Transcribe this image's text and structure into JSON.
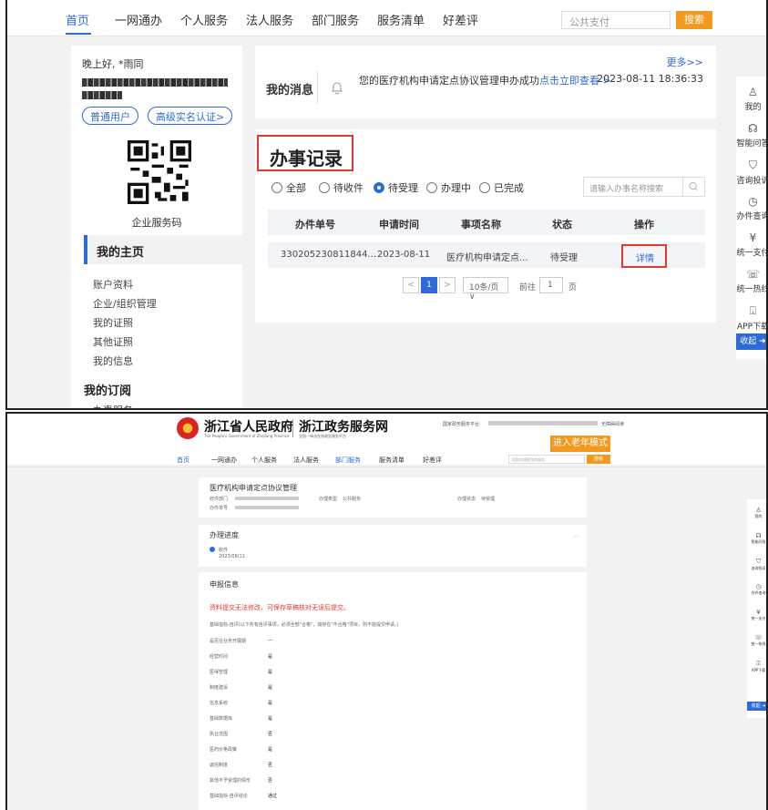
{
  "top": {
    "nav": {
      "items": [
        "首页",
        "一网通办",
        "个人服务",
        "法人服务",
        "部门服务",
        "服务清单",
        "好差评"
      ],
      "search_placeholder": "公共支付",
      "search_button": "搜索"
    },
    "profile": {
      "greeting": "晚上好, *雨同",
      "badge_user": "普通用户",
      "badge_auth": "高级实名认证>",
      "qr_label": "企业服务码",
      "home_title": "我的主页",
      "menu": [
        "账户资料",
        "企业/组织管理",
        "我的证照",
        "其他证照",
        "我的信息"
      ],
      "subscription_title": "我的订阅",
      "subscription_item": "办事服务"
    },
    "messages": {
      "more": "更多>>",
      "title": "我的消息",
      "text": "您的医疗机构申请定点协议管理申办成功",
      "link": "点击立即查看 >",
      "time": "2023-08-11 18:36:33"
    },
    "records": {
      "title": "办事记录",
      "filters": [
        "全部",
        "待收件",
        "待受理",
        "办理中",
        "已完成"
      ],
      "selected_filter": "待受理",
      "search_placeholder": "请输入办事名称搜索",
      "columns": [
        "办件单号",
        "申请时间",
        "事项名称",
        "状态",
        "操作"
      ],
      "row": {
        "id": "330205230811844...",
        "date": "2023-08-11",
        "name": "医疗机构申请定点...",
        "status": "待受理",
        "action": "详情"
      },
      "pager": {
        "prev": "<",
        "current": "1",
        "next": ">",
        "per_page": "10条/页 ∨",
        "goto": "前往",
        "goto_page": "1",
        "page_unit": "页"
      }
    },
    "rail": [
      "我的",
      "智能问答",
      "咨询投诉",
      "办件查询",
      "统一支付",
      "统一热线",
      "APP下载"
    ],
    "rail_icons": [
      "person-icon",
      "headset-icon",
      "shield-icon",
      "history-icon",
      "yen-icon",
      "phone-icon",
      "download-icon"
    ],
    "rail_collapse": "收起"
  },
  "bottom": {
    "header": {
      "gov_name": "浙江省人民政府",
      "gov_en": "The People's Government of Zhejiang Province",
      "platform_name": "浙江政务服务网",
      "platform_sub": "全国一体化在线政务服务平台",
      "top_link": "国家政务服务平台",
      "login_link": "无障碍阅读",
      "elder_mode": "进入老年模式"
    },
    "nav": {
      "items": [
        "首页",
        "一网通办",
        "个人服务",
        "法人服务",
        "部门服务",
        "服务清单",
        "好差评"
      ],
      "search_placeholder": "搜索你想要找的服务",
      "search_button": "搜索"
    },
    "case": {
      "title": "医疗机构申请定点协议管理",
      "dept_label": "收件部门",
      "type_label": "办理类型",
      "type_value": "公共服务",
      "status_label": "办理状态",
      "status_value": "待受理",
      "id_label": "办件单号"
    },
    "progress": {
      "title": "办理进度",
      "step": "收件",
      "step_date": "2023/08/11"
    },
    "info": {
      "title": "申报信息",
      "warning": "资料提交无法修改，可保存草稿核对无误后提交。",
      "note": "基础指标-自评(以下所有自评事项，必须全部\"合格\"，如存在\"不合格\"项目，则不能提交申请。)",
      "rows": [
        {
          "label": "是否在业务开展期",
          "value": "—"
        },
        {
          "label": "经营时间",
          "value": "是"
        },
        {
          "label": "医保管理",
          "value": "是"
        },
        {
          "label": "制度建设",
          "value": "是"
        },
        {
          "label": "信息系统",
          "value": "是"
        },
        {
          "label": "基础数据库",
          "value": "是"
        },
        {
          "label": "执业范围",
          "value": "否"
        },
        {
          "label": "医药价格政策",
          "value": "是"
        },
        {
          "label": "诚信制度",
          "value": "否"
        },
        {
          "label": "其他不予受理的情形",
          "value": "否"
        },
        {
          "label": "基础指标-自评结论",
          "value": "通过"
        }
      ]
    },
    "rail": [
      "我的",
      "智能问答",
      "咨询投诉",
      "办件查询",
      "统一支付",
      "统一热线",
      "APP下载"
    ],
    "rail_collapse": "收起"
  }
}
